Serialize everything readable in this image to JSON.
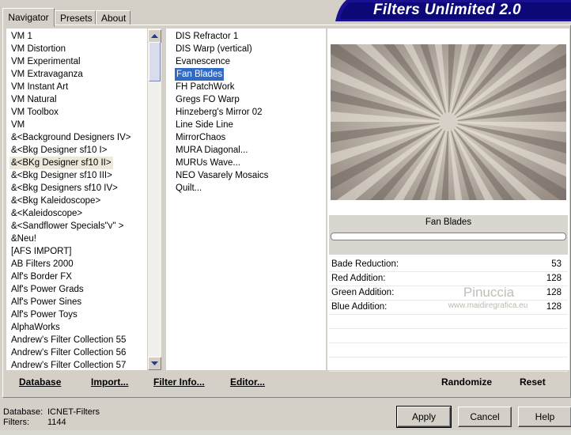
{
  "tabs": [
    {
      "label": "Navigator",
      "active": true
    },
    {
      "label": "Presets",
      "active": false
    },
    {
      "label": "About",
      "active": false
    }
  ],
  "app_title": "Filters Unlimited 2.0",
  "categories": [
    "VM 1",
    "VM Distortion",
    "VM Experimental",
    "VM Extravaganza",
    "VM Instant Art",
    "VM Natural",
    "VM Toolbox",
    "VM",
    "&<Background Designers IV>",
    "&<Bkg Designer sf10 I>",
    "&<BKg Designer sf10 II>",
    "&<Bkg Designer sf10 III>",
    "&<Bkg Designers sf10 IV>",
    "&<Bkg Kaleidoscope>",
    "&<Kaleidoscope>",
    "&<Sandflower Specials\"v\" >",
    "&Neu!",
    "[AFS IMPORT]",
    "AB Filters 2000",
    "Alf's Border FX",
    "Alf's Power Grads",
    "Alf's Power Sines",
    "Alf's Power Toys",
    "AlphaWorks",
    "Andrew's Filter Collection 55",
    "Andrew's Filter Collection 56",
    "Andrew's Filter Collection 57"
  ],
  "selected_category": "&<BKg Designer sf10 II>",
  "filters": [
    "DIS Refractor 1",
    "DIS Warp (vertical)",
    "Evanescence",
    "Fan Blades",
    "FH PatchWork",
    "Gregs FO Warp",
    "Hinzeberg's Mirror 02",
    "Line Side Line",
    "MirrorChaos",
    "MURA Diagonal...",
    "MURUs Wave...",
    "NEO Vasarely Mosaics",
    "Quilt..."
  ],
  "selected_filter": "Fan Blades",
  "preview": {
    "filter_name": "Fan Blades",
    "params": [
      {
        "name": "Bade Reduction:",
        "value": "53"
      },
      {
        "name": "Red Addition:",
        "value": "128"
      },
      {
        "name": "Green Addition:",
        "value": "128"
      },
      {
        "name": "Blue Addition:",
        "value": "128"
      }
    ],
    "watermark_title": "Pinuccia",
    "watermark_url": "www.maidiregrafica.eu"
  },
  "bottom_links": {
    "database": "Database",
    "import": "Import...",
    "filter_info": "Filter Info...",
    "editor": "Editor...",
    "randomize": "Randomize",
    "reset": "Reset"
  },
  "footer": {
    "database_label": "Database:",
    "database_value": "ICNET-Filters",
    "filters_label": "Filters:",
    "filters_value": "1144"
  },
  "buttons": {
    "apply": "Apply",
    "cancel": "Cancel",
    "help": "Help"
  }
}
